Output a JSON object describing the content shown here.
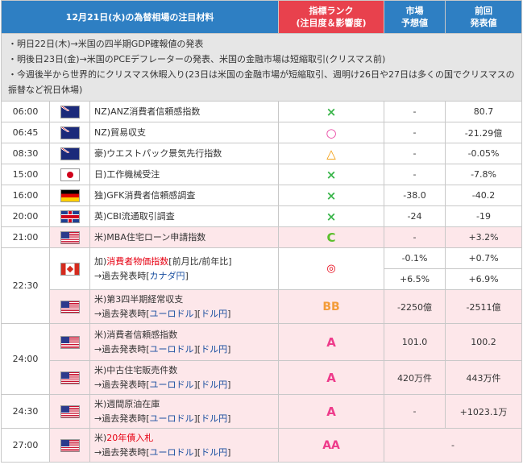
{
  "header": {
    "title": "12月21日(水)の為替相場の注目材料",
    "rank_line1": "指標ランク",
    "rank_line2": "(注目度＆影響度)",
    "market_line1": "市場",
    "market_line2": "予想値",
    "prev_line1": "前回",
    "prev_line2": "発表値"
  },
  "notes": [
    "・明日22日(木)→米国の四半期GDP確報値の発表",
    "・明後日23日(金)→米国のPCEデフレーターの発表、米国の金融市場は短縮取引(クリスマス前)",
    "・今週後半から世界的にクリスマス休暇入り(23日は米国の金融市場が短縮取引、週明け26日や27日は多くの国でクリスマスの振替など祝日休場)"
  ],
  "rows": [
    {
      "time": "06:00",
      "flag": "nz-flag",
      "prefix": "NZ)",
      "name": "ANZ消費者信頼感指数",
      "mark": "×",
      "forecast": "-",
      "previous": "80.7"
    },
    {
      "time": "06:45",
      "flag": "nz-flag",
      "prefix": "NZ)",
      "name": "貿易収支",
      "mark": "○",
      "forecast": "-",
      "previous": "-21.29億"
    },
    {
      "time": "08:30",
      "flag": "au-flag",
      "prefix": "豪)",
      "name": "ウエストパック景気先行指数",
      "mark": "△",
      "forecast": "-",
      "previous": "-0.05%"
    },
    {
      "time": "15:00",
      "flag": "jp-flag",
      "prefix": "日)",
      "name": "工作機械受注",
      "mark": "×",
      "forecast": "-",
      "previous": "-7.8%"
    },
    {
      "time": "16:00",
      "flag": "de-flag",
      "prefix": "独)",
      "name": "GFK消費者信頼感調査",
      "mark": "×",
      "forecast": "-38.0",
      "previous": "-40.2"
    },
    {
      "time": "20:00",
      "flag": "uk-flag",
      "prefix": "英)",
      "name": "CBI流通取引調査",
      "mark": "×",
      "forecast": "-24",
      "previous": "-19"
    },
    {
      "time": "21:00",
      "flag": "us-flag",
      "prefix": "米)",
      "name": "MBA住宅ローン申請指数",
      "mark": "C",
      "forecast": "-",
      "previous": "+3.2%"
    }
  ],
  "ca_cpi": {
    "time": "22:30",
    "prefix": "加)",
    "name_red": "消費者物価指数",
    "name_suffix": "[前月比/前年比]",
    "link_prefix": "→過去発表時[",
    "link1": "カナダ円",
    "link_suffix": "]",
    "mark": "◎",
    "forecast_mom": "-0.1%",
    "previous_mom": "+0.7%",
    "forecast_yoy": "+6.5%",
    "previous_yoy": "+6.9%"
  },
  "us_current": {
    "prefix": "米)",
    "name": "第3四半期経常収支",
    "link_prefix": "→過去発表時[",
    "link1": "ユーロドル",
    "link_mid": "][",
    "link2": "ドル円",
    "link_suffix": "]",
    "mark": "BB",
    "forecast": "-2250億",
    "previous": "-2511億"
  },
  "us_conf": {
    "time": "24:00",
    "prefix": "米)",
    "name": "消費者信頼感指数",
    "link_prefix": "→過去発表時[",
    "link1": "ユーロドル",
    "link_mid": "][",
    "link2": "ドル円",
    "link_suffix": "]",
    "mark": "A",
    "forecast": "101.0",
    "previous": "100.2"
  },
  "us_home": {
    "prefix": "米)",
    "name": "中古住宅販売件数",
    "link_prefix": "→過去発表時[",
    "link1": "ユーロドル",
    "link_mid": "][",
    "link2": "ドル円",
    "link_suffix": "]",
    "mark": "A",
    "forecast": "420万件",
    "previous": "443万件"
  },
  "us_oil": {
    "time": "24:30",
    "prefix": "米)",
    "name": "週間原油在庫",
    "link_prefix": "→過去発表時[",
    "link1": "ユーロドル",
    "link_mid": "][",
    "link2": "ドル円",
    "link_suffix": "]",
    "mark": "A",
    "forecast": "-",
    "previous": "+1023.1万"
  },
  "us_bond": {
    "time": "27:00",
    "prefix": "米)",
    "name_red": "20年債入札",
    "link_prefix": "→過去発表時[",
    "link1": "ユーロドル",
    "link_mid": "][",
    "link2": "ドル円",
    "link_suffix": "]",
    "mark": "AA",
    "result": "-"
  },
  "colors": {
    "header_blue": "#2e7fc3",
    "header_red": "#e8414d",
    "notes_bg": "#e6e6e6",
    "pink_bg": "#fde7ea",
    "link_blue": "#1a4fa0",
    "alert_red": "#e60012"
  }
}
